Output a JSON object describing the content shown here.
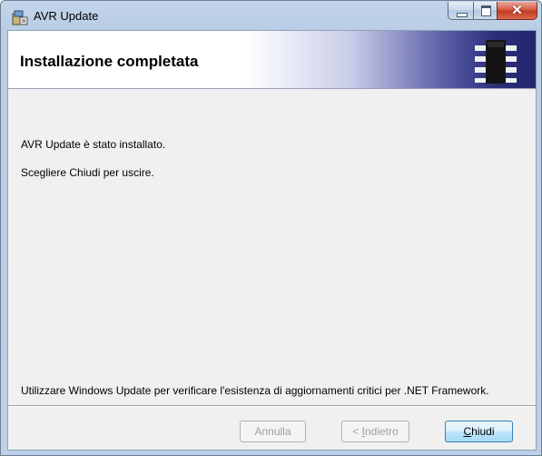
{
  "window": {
    "title": "AVR Update",
    "icon": "installer-icon"
  },
  "title_controls": {
    "minimize_icon": "minimize-icon",
    "maximize_icon": "maximize-icon",
    "close_glyph": "✕"
  },
  "banner": {
    "title": "Installazione completata",
    "graphic": "chip-icon"
  },
  "content": {
    "line1": "AVR Update è stato installato.",
    "line2": "Scegliere Chiudi per uscire.",
    "note": "Utilizzare Windows Update per verificare l'esistenza di aggiornamenti critici per .NET Framework."
  },
  "buttons": {
    "cancel": "Annulla",
    "back_prefix": "< ",
    "back_mnemonic": "I",
    "back_rest": "ndietro",
    "close_mnemonic": "C",
    "close_rest": "hiudi"
  }
}
